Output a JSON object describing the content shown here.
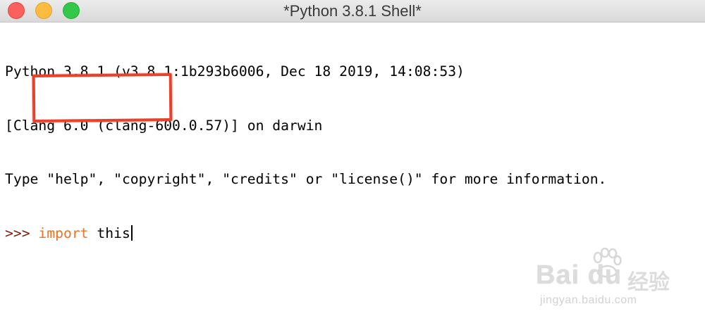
{
  "window": {
    "title": "*Python 3.8.1 Shell*"
  },
  "console": {
    "lines": [
      "Python 3.8.1 (v3.8.1:1b293b6006, Dec 18 2019, 14:08:53)",
      "[Clang 6.0 (clang-600.0.57)] on darwin",
      "Type \"help\", \"copyright\", \"credits\" or \"license()\" for more information."
    ],
    "prompt": ">>>",
    "input_keyword": "import",
    "input_rest": "this"
  },
  "colors": {
    "prompt": "#7f1d0d",
    "keyword": "#e8742c",
    "highlight_box": "#e8412c"
  },
  "watermark": {
    "brand": "Bai du",
    "brand_cn": "经验",
    "url": "jingyan.baidu.com"
  },
  "icons": {
    "close": "close-traffic-light-icon",
    "minimize": "minimize-traffic-light-icon",
    "zoom": "zoom-traffic-light-icon",
    "paw": "baidu-paw-icon"
  }
}
